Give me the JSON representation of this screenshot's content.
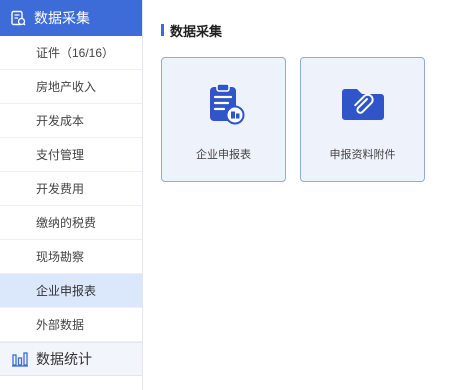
{
  "sidebar": {
    "header": {
      "label": "数据采集",
      "icon": "data-collect-icon"
    },
    "items": [
      {
        "label": "证件（16/16）"
      },
      {
        "label": "房地产收入"
      },
      {
        "label": "开发成本"
      },
      {
        "label": "支付管理"
      },
      {
        "label": "开发费用"
      },
      {
        "label": "缴纳的税费"
      },
      {
        "label": "现场勘察"
      },
      {
        "label": "企业申报表",
        "active": true
      },
      {
        "label": "外部数据"
      }
    ],
    "footer": {
      "label": "数据统计",
      "icon": "bar-chart-icon"
    }
  },
  "main": {
    "section_title": "数据采集",
    "cards": [
      {
        "label": "企业申报表",
        "icon": "clipboard-report-icon"
      },
      {
        "label": "申报资料附件",
        "icon": "paperclip-folder-icon"
      }
    ]
  },
  "colors": {
    "accent": "#3d6bd8",
    "active_item_bg": "#dbe7fa",
    "card_bg": "#eef2fa",
    "card_border": "#93acd9"
  }
}
